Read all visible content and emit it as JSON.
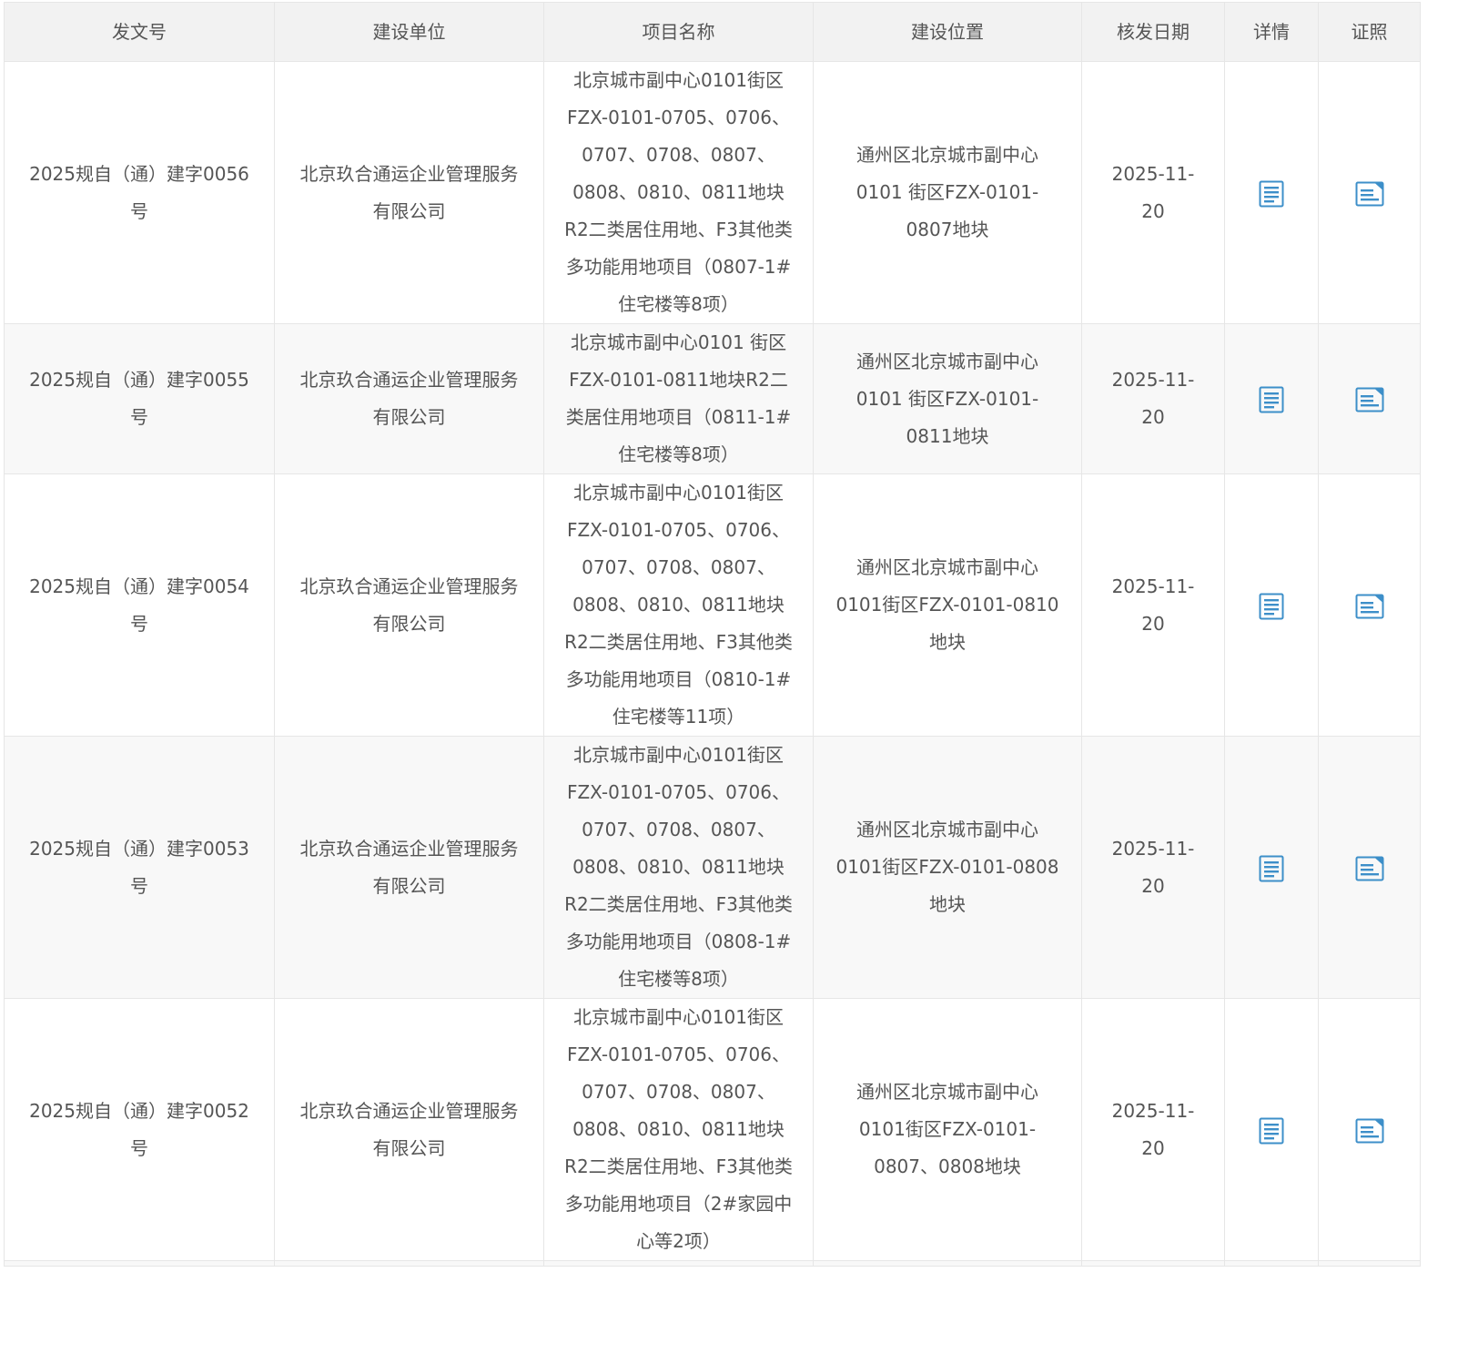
{
  "columns": {
    "doc_no": "发文号",
    "unit": "建设单位",
    "project": "项目名称",
    "location": "建设位置",
    "date": "核发日期",
    "detail": "详情",
    "license": "证照"
  },
  "icons": {
    "detail": "document-lines-icon",
    "license": "certificate-icon",
    "color": "#3d8fc9"
  },
  "rows": [
    {
      "doc_no": "2025规自（通）建字0056号",
      "unit": "北京玖合通运企业管理服务有限公司",
      "project": "北京城市副中心0101街区FZX-0101-0705、0706、0707、0708、0807、0808、0810、0811地块R2二类居住用地、F3其他类多功能用地项目（0807-1#住宅楼等8项）",
      "location": "通州区北京城市副中心0101 街区FZX-0101-0807地块",
      "date": "2025-11-20"
    },
    {
      "doc_no": "2025规自（通）建字0055号",
      "unit": "北京玖合通运企业管理服务有限公司",
      "project": "北京城市副中心0101 街区FZX-0101-0811地块R2二类居住用地项目（0811-1#住宅楼等8项）",
      "location": "通州区北京城市副中心0101 街区FZX-0101-0811地块",
      "date": "2025-11-20"
    },
    {
      "doc_no": "2025规自（通）建字0054号",
      "unit": "北京玖合通运企业管理服务有限公司",
      "project": "北京城市副中心0101街区FZX-0101-0705、0706、0707、0708、0807、0808、0810、0811地块R2二类居住用地、F3其他类多功能用地项目（0810-1#住宅楼等11项）",
      "location": "通州区北京城市副中心0101街区FZX-0101-0810地块",
      "date": "2025-11-20"
    },
    {
      "doc_no": "2025规自（通）建字0053号",
      "unit": "北京玖合通运企业管理服务有限公司",
      "project": "北京城市副中心0101街区FZX-0101-0705、0706、0707、0708、0807、0808、0810、0811地块R2二类居住用地、F3其他类多功能用地项目（0808-1#住宅楼等8项）",
      "location": "通州区北京城市副中心0101街区FZX-0101-0808地块",
      "date": "2025-11-20"
    },
    {
      "doc_no": "2025规自（通）建字0052号",
      "unit": "北京玖合通运企业管理服务有限公司",
      "project": "北京城市副中心0101街区FZX-0101-0705、0706、0707、0708、0807、0808、0810、0811地块R2二类居住用地、F3其他类多功能用地项目（2#家园中心等2项）",
      "location": "通州区北京城市副中心0101街区FZX-0101-0807、0808地块",
      "date": "2025-11-20"
    }
  ]
}
